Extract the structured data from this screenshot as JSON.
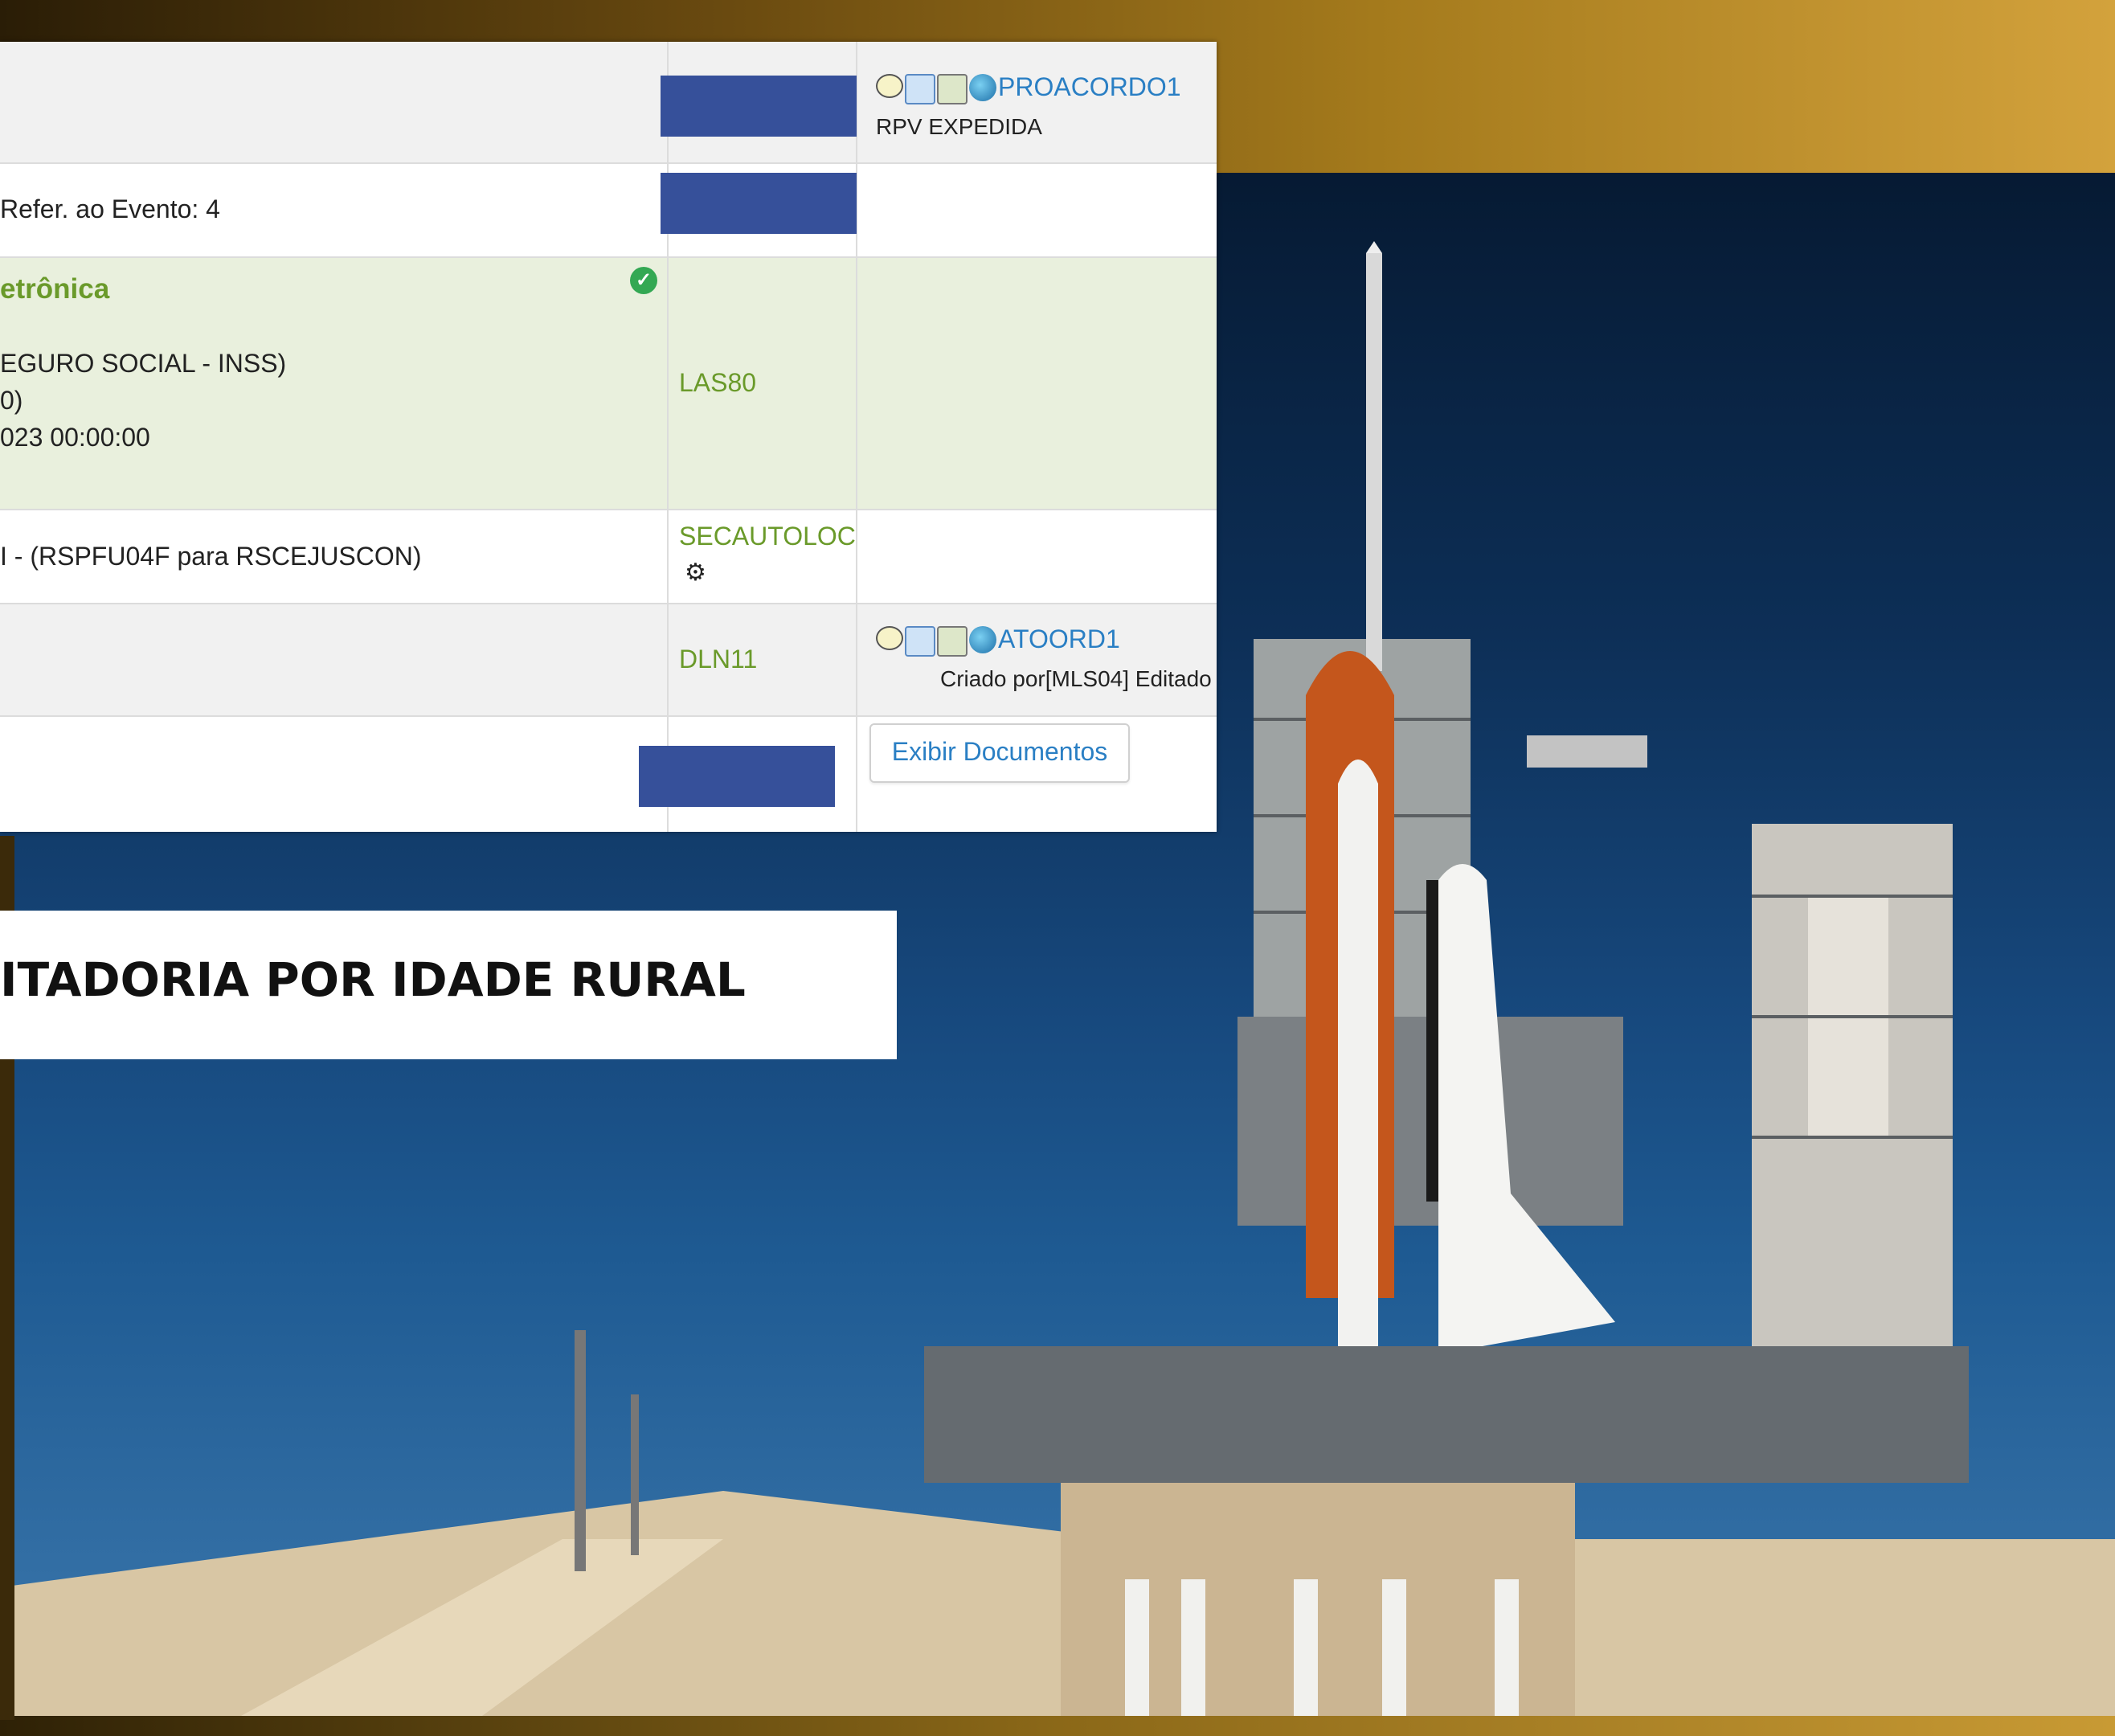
{
  "table": {
    "row1": {
      "action_link": "PROACORDO1",
      "status": "RPV EXPEDIDA",
      "icons": [
        "comment-icon",
        "edit-icon",
        "print-icon",
        "globe-icon"
      ]
    },
    "row2": {
      "description": "Refer. ao Evento: 4"
    },
    "row3": {
      "title": "etrônica",
      "line1": "EGURO SOCIAL - INSS)",
      "line2": "0)",
      "line3": "023 00:00:00",
      "user": "LAS80",
      "status_icon": "check-circle-icon"
    },
    "row4": {
      "description": "I - (RSPFU04F para RSCEJUSCON)",
      "user": "SECAUTOLOC",
      "user_icon": "gears-icon"
    },
    "row5": {
      "user": "DLN11",
      "action_link": "ATOORD1",
      "note": "Criado por[MLS04] Editado",
      "icons": [
        "comment-icon",
        "edit-icon",
        "print-icon",
        "globe-icon"
      ]
    },
    "row6": {
      "button_label": "Exibir Documentos"
    }
  },
  "banner": {
    "text": "ITADORIA POR IDADE RURAL"
  },
  "colors": {
    "redaction": "#36509a",
    "user_green": "#6a9a2a",
    "link_blue": "#2a7fc4"
  }
}
